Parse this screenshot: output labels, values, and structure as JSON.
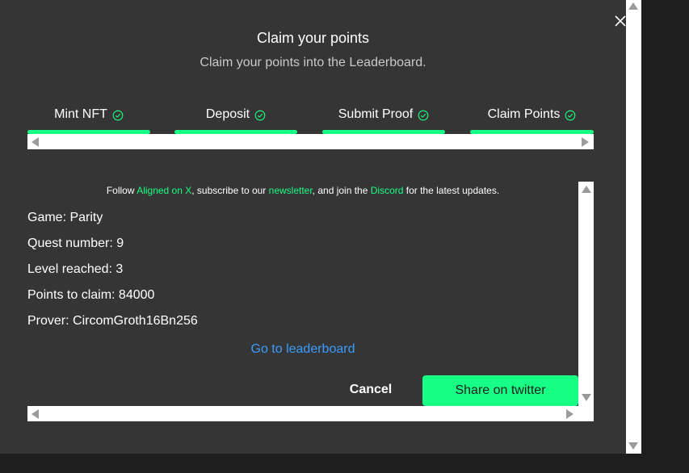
{
  "modal": {
    "title": "Claim your points",
    "subtitle": "Claim your points into the Leaderboard."
  },
  "steps": [
    {
      "label": "Mint NFT",
      "status": "done"
    },
    {
      "label": "Deposit",
      "status": "done"
    },
    {
      "label": "Submit Proof",
      "status": "done"
    },
    {
      "label": "Claim Points",
      "status": "done"
    }
  ],
  "info": {
    "prefix": "Follow ",
    "link1": "Aligned on X",
    "mid1": ", subscribe to our ",
    "link2": "newsletter",
    "mid2": ", and join the ",
    "link3": "Discord",
    "suffix": " for the latest updates."
  },
  "details": {
    "game": "Game: Parity",
    "quest": "Quest number: 9",
    "level": "Level reached: 3",
    "points": "Points to claim: 84000",
    "prover": "Prover: CircomGroth16Bn256"
  },
  "actions": {
    "leaderboard_link": "Go to leaderboard",
    "cancel_label": "Cancel",
    "share_label": "Share on twitter"
  },
  "colors": {
    "accent": "#17ff84",
    "link_blue": "#3b9cff",
    "background": "#353535"
  },
  "icons": {
    "close": "close-icon",
    "step_done": "check-circle-icon"
  }
}
